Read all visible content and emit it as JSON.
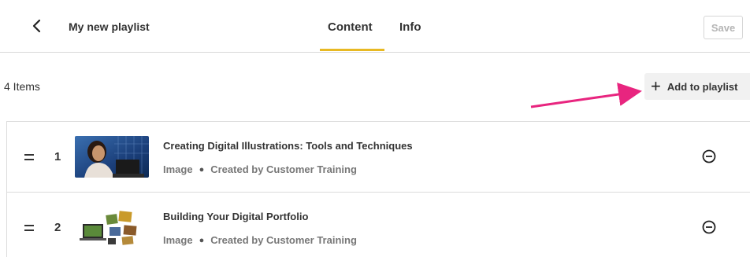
{
  "header": {
    "title": "My new playlist",
    "tabs": [
      {
        "label": "Content",
        "active": true
      },
      {
        "label": "Info",
        "active": false
      }
    ],
    "save_label": "Save",
    "accent_color": "#e8b923"
  },
  "toolbar": {
    "items_count": "4 Items",
    "add_label": "Add to playlist",
    "annotation_arrow_color": "#e8257f"
  },
  "items": [
    {
      "index": "1",
      "title": "Creating Digital Illustrations: Tools and Techniques",
      "type": "Image",
      "creator": "Created by Customer Training",
      "thumbnail": "woman-at-laptop-thumbnail"
    },
    {
      "index": "2",
      "title": "Building Your Digital Portfolio",
      "type": "Image",
      "creator": "Created by Customer Training",
      "thumbnail": "devices-portfolio-thumbnail"
    }
  ]
}
